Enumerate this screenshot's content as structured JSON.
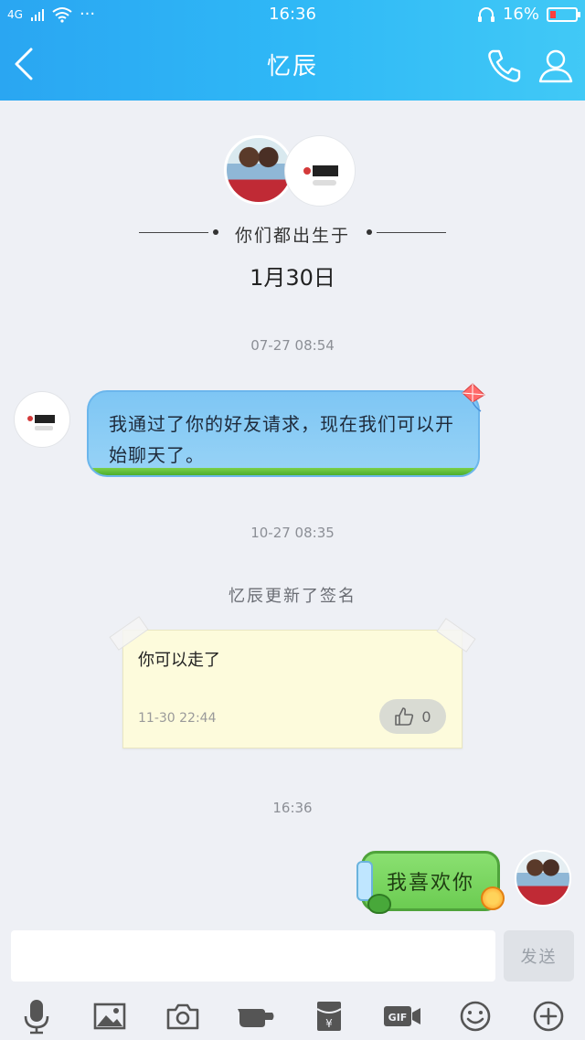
{
  "status_bar": {
    "network": "4G",
    "dots": "···",
    "time": "16:36",
    "battery": "16%"
  },
  "header": {
    "title": "忆辰"
  },
  "intro": {
    "birth_text": "你们都出生于",
    "birth_date": "1月30日"
  },
  "messages": {
    "ts1": "07-27 08:54",
    "received_text": "我通过了你的好友请求，现在我们可以开始聊天了。",
    "ts2": "10-27 08:35",
    "signature_update": "忆辰更新了签名",
    "signature": {
      "text": "你可以走了",
      "time": "11-30 22:44",
      "likes": "0"
    },
    "ts3": "16:36",
    "sent_text": "我喜欢你"
  },
  "input": {
    "placeholder": "",
    "send_label": "发送"
  },
  "toolbar": {
    "icons": [
      "microphone-icon",
      "image-icon",
      "camera-icon",
      "poke-icon",
      "red-packet-icon",
      "gif-icon",
      "emoji-icon",
      "plus-icon"
    ]
  },
  "colors": {
    "header_start": "#2aa6f2",
    "header_end": "#41c9f6",
    "background": "#eef0f5"
  }
}
